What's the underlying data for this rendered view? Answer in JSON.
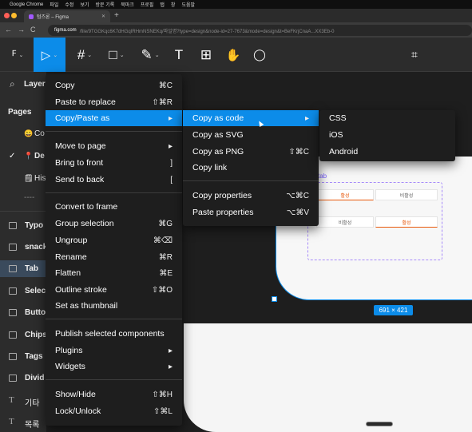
{
  "menubar": {
    "apple": "",
    "items": [
      "Google Chrome",
      "파일",
      "수정",
      "보기",
      "방문 기록",
      "북마크",
      "프로필",
      "탭",
      "창",
      "도움말"
    ]
  },
  "browser": {
    "tab_title": "텀즈론 – Figma",
    "tab_close": "✕",
    "new_tab": "+",
    "back": "←",
    "forward": "→",
    "reload": "C",
    "url_host": "figma.com",
    "url_rest": "/file/9TGGKqc6K7dHGqIRHmNSNEKq/파일명?type=design&node-id=27-7673&mode=design&t=BeFKrjCnaA...XX3Eb-0"
  },
  "toolbar": {
    "main_menu_glyph": "ꟳ",
    "move_glyph": "▷",
    "frame_glyph": "#",
    "rect_glyph": "□",
    "pen_glyph": "✎",
    "text_glyph": "T",
    "resources_glyph": "⊞",
    "hand_glyph": "✋",
    "comment_glyph": "◯",
    "dev_glyph": "⌗",
    "chevron": "⌄"
  },
  "left_panel": {
    "search_glyph": "⌕",
    "layers_label": "Layer",
    "pages_label": "Pages",
    "pages": [
      "Co",
      "De",
      "His"
    ],
    "page_emojis": [
      "😀",
      "📍",
      "🗒"
    ],
    "page_check": "✓",
    "divider": "----",
    "layers": [
      "Typo",
      "snack",
      "Tab",
      "Selec",
      "Butto",
      "Chips",
      "Tags",
      "Divid",
      "기타",
      "목록"
    ]
  },
  "canvas": {
    "frame_label": "tab",
    "chips_row1": [
      "활성",
      "비활성"
    ],
    "chips_row2": [
      "비활성",
      "활성"
    ],
    "size_badge": "691 × 421"
  },
  "context_menu": {
    "items": [
      {
        "label": "Copy",
        "shortcut": "⌘C"
      },
      {
        "label": "Paste to replace",
        "shortcut": "⇧⌘R"
      },
      {
        "label": "Copy/Paste as",
        "shortcut": "▸"
      },
      {
        "label": "Move to page",
        "shortcut": "▸"
      },
      {
        "label": "Bring to front",
        "shortcut": "]"
      },
      {
        "label": "Send to back",
        "shortcut": "["
      },
      {
        "label": "Convert to frame",
        "shortcut": ""
      },
      {
        "label": "Group selection",
        "shortcut": "⌘G"
      },
      {
        "label": "Ungroup",
        "shortcut": "⌘⌫"
      },
      {
        "label": "Rename",
        "shortcut": "⌘R"
      },
      {
        "label": "Flatten",
        "shortcut": "⌘E"
      },
      {
        "label": "Outline stroke",
        "shortcut": "⇧⌘O"
      },
      {
        "label": "Set as thumbnail",
        "shortcut": ""
      },
      {
        "label": "Publish selected components",
        "shortcut": ""
      },
      {
        "label": "Plugins",
        "shortcut": "▸"
      },
      {
        "label": "Widgets",
        "shortcut": "▸"
      },
      {
        "label": "Show/Hide",
        "shortcut": "⇧⌘H"
      },
      {
        "label": "Lock/Unlock",
        "shortcut": "⇧⌘L"
      }
    ]
  },
  "submenu": {
    "items": [
      {
        "label": "Copy as code",
        "shortcut": "▸"
      },
      {
        "label": "Copy as SVG",
        "shortcut": ""
      },
      {
        "label": "Copy as PNG",
        "shortcut": "⇧⌘C"
      },
      {
        "label": "Copy link",
        "shortcut": ""
      },
      {
        "label": "Copy properties",
        "shortcut": "⌥⌘C"
      },
      {
        "label": "Paste properties",
        "shortcut": "⌥⌘V"
      }
    ]
  },
  "code_menu": {
    "items": [
      "CSS",
      "iOS",
      "Android"
    ]
  },
  "colors": {
    "accent": "#0c8ce9",
    "panel": "#2c2c2c",
    "menu_bg": "#1e1e1e"
  }
}
